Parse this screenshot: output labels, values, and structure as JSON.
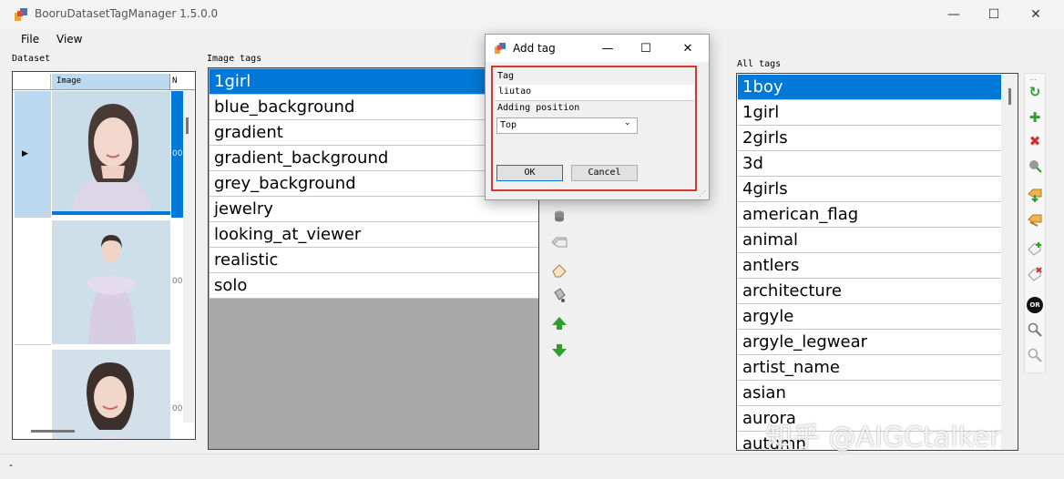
{
  "window": {
    "title": "BooruDatasetTagManager 1.5.0.0",
    "minimize": "—",
    "maximize": "☐",
    "close": "✕"
  },
  "menu": [
    "File",
    "View"
  ],
  "dataset": {
    "label": "Dataset",
    "columns": {
      "image": "Image",
      "n": "N"
    },
    "rows": [
      {
        "selected": true,
        "arrow": "▶",
        "n": "00"
      },
      {
        "selected": false,
        "arrow": "",
        "n": "00"
      },
      {
        "selected": false,
        "arrow": "",
        "n": "00"
      }
    ]
  },
  "image_tags": {
    "label": "Image tags",
    "items": [
      "1girl",
      "blue_background",
      "gradient",
      "gradient_background",
      "grey_background",
      "jewelry",
      "looking_at_viewer",
      "realistic",
      "solo"
    ],
    "selected_index": 0
  },
  "all_tags": {
    "label": "All tags",
    "items": [
      "1boy",
      "1girl",
      "2girls",
      "3d",
      "4girls",
      "american_flag",
      "animal",
      "antlers",
      "architecture",
      "argyle",
      "argyle_legwear",
      "artist_name",
      "asian",
      "aurora",
      "autumn"
    ],
    "selected_index": 0
  },
  "mid_toolbar_icons": [
    "disk-stack-icon",
    "tags-icon",
    "eraser-icon",
    "paint-bucket-icon",
    "move-up-icon",
    "move-down-icon"
  ],
  "right_toolbar_icons": [
    "refresh-icon",
    "add-icon",
    "delete-icon",
    "replace-icon",
    "import-icon",
    "export-icon",
    "tag-add-icon",
    "tag-remove-icon",
    "or-icon",
    "search-icon",
    "search-clear-icon"
  ],
  "right_toolbar_glyphs": {
    "refresh": "↻",
    "add": "✚",
    "delete": "✖",
    "or": "OR",
    "search": "🔍"
  },
  "colors": {
    "accent": "#0078d7",
    "delete": "#d32f2f",
    "add": "#2e9e2e",
    "highlight": "#d0383a"
  },
  "statusbar": {
    "text": "-"
  },
  "watermark": "知乎 @AIGCtalker",
  "dialog": {
    "title": "Add tag",
    "minimize": "—",
    "maximize": "☐",
    "close": "✕",
    "tag_label": "Tag",
    "tag_value": "liutao",
    "position_label": "Adding position",
    "position_value": "Top",
    "ok": "OK",
    "cancel": "Cancel"
  }
}
